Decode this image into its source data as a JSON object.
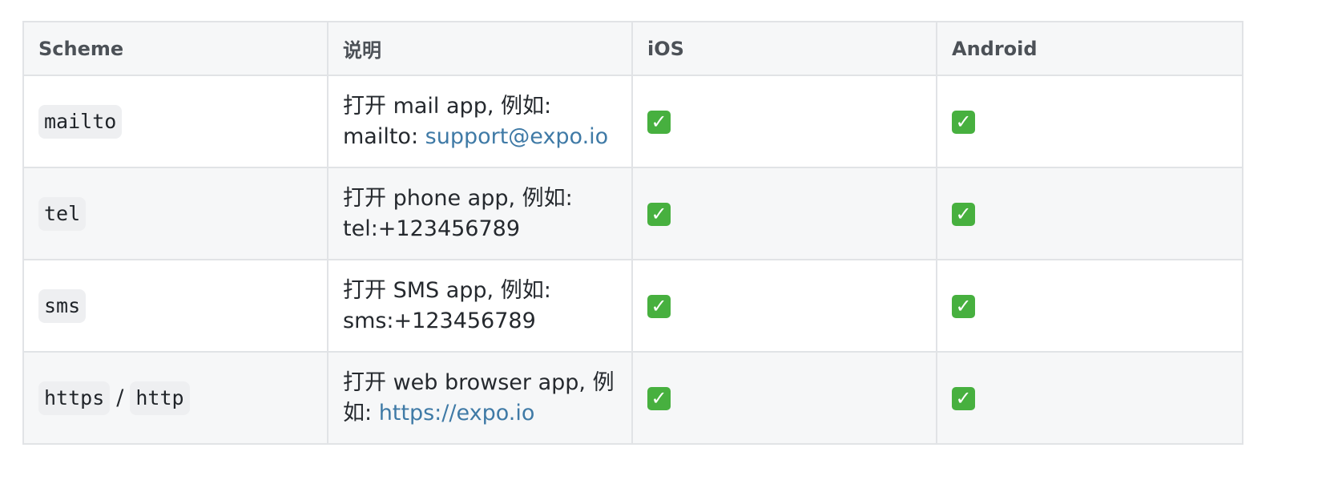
{
  "header": {
    "scheme": "Scheme",
    "description": "说明",
    "ios": "iOS",
    "android": "Android"
  },
  "rows": [
    {
      "scheme": [
        "mailto"
      ],
      "desc_lead": "打开 mail app, 例如: mailto: ",
      "desc_link": "support@expo.io",
      "ios": "✓",
      "android": "✓"
    },
    {
      "scheme": [
        "tel"
      ],
      "desc_lead": "打开 phone app, 例如: tel:+123456789",
      "desc_link": "",
      "ios": "✓",
      "android": "✓"
    },
    {
      "scheme": [
        "sms"
      ],
      "desc_lead": "打开 SMS app, 例如: sms:+123456789",
      "desc_link": "",
      "ios": "✓",
      "android": "✓"
    },
    {
      "scheme": [
        "https",
        "http"
      ],
      "scheme_separator": "/",
      "desc_lead": "打开 web browser app, 例如: ",
      "desc_link": "https://expo.io",
      "ios": "✓",
      "android": "✓"
    }
  ]
}
